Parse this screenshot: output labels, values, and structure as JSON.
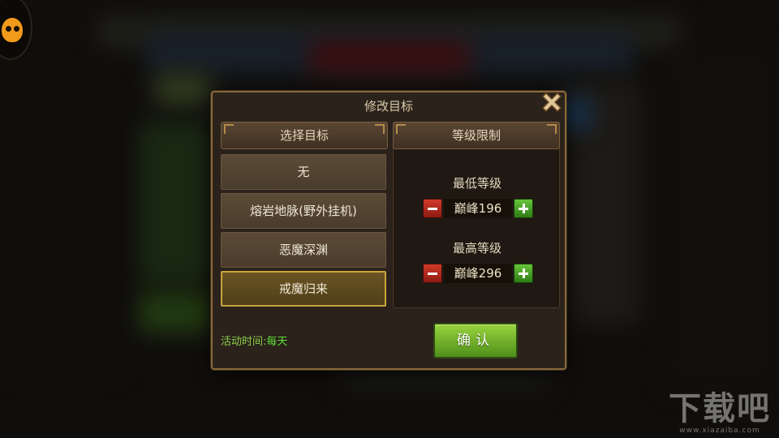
{
  "dialog": {
    "title": "修改目标",
    "close_icon": "close-x-icon"
  },
  "target_panel": {
    "header": "选择目标",
    "items": [
      {
        "label": "无",
        "selected": false
      },
      {
        "label": "熔岩地脉(野外挂机)",
        "selected": false
      },
      {
        "label": "恶魔深渊",
        "selected": false
      },
      {
        "label": "戒魔归来",
        "selected": true
      }
    ]
  },
  "level_panel": {
    "header": "等级限制",
    "min": {
      "title": "最低等级",
      "value": "巅峰196"
    },
    "max": {
      "title": "最高等级",
      "value": "巅峰296"
    }
  },
  "activity": {
    "label": "活动时间:",
    "value": "每天"
  },
  "confirm_label": "确认",
  "watermark": {
    "main": "下载吧",
    "site": "www.xiazaiba.com"
  },
  "colors": {
    "accent_gold": "#c9a53c",
    "confirm_green": "#6fb52a",
    "minus_red": "#c0302a",
    "plus_green": "#4fa52c",
    "activity_green": "#5fe03a"
  }
}
